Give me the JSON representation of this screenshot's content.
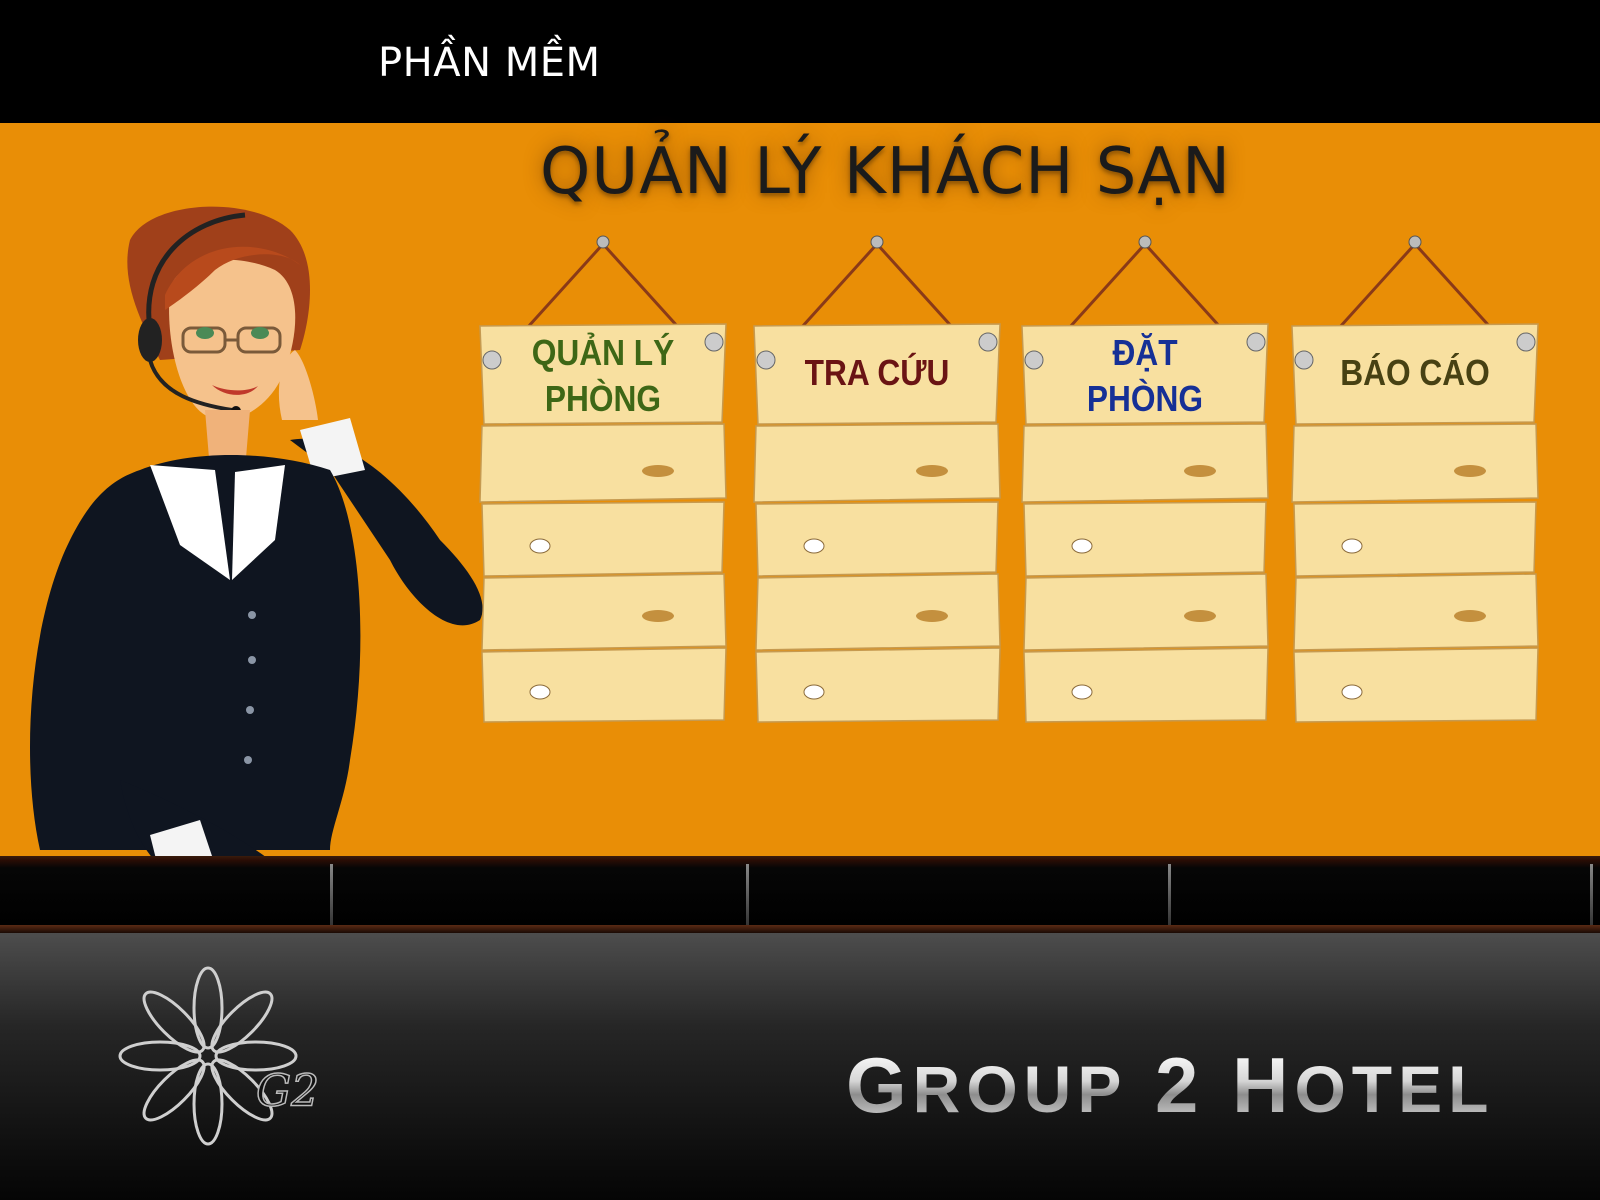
{
  "header": {
    "label": "PHẦN MỀM"
  },
  "main": {
    "title": "QUẢN LÝ KHÁCH SẠN",
    "menu": [
      {
        "line1": "QUẢN LÝ",
        "line2": "PHÒNG",
        "color": "#3e6716"
      },
      {
        "line1": "TRA CỨU",
        "line2": "",
        "color": "#6a1414"
      },
      {
        "line1": "ĐẶT",
        "line2": "PHÒNG",
        "color": "#163096"
      },
      {
        "line1": "BÁO CÁO",
        "line2": "",
        "color": "#474113"
      }
    ]
  },
  "footer": {
    "logo_text": "G2",
    "brand": {
      "word1_initial": "G",
      "word1_rest": "ROUP",
      "number": "2",
      "word2_initial": "H",
      "word2_rest": "OTEL"
    }
  },
  "colors": {
    "stage": "#e98e06",
    "wood": "#fbe6a6",
    "topbar": "#000000"
  }
}
